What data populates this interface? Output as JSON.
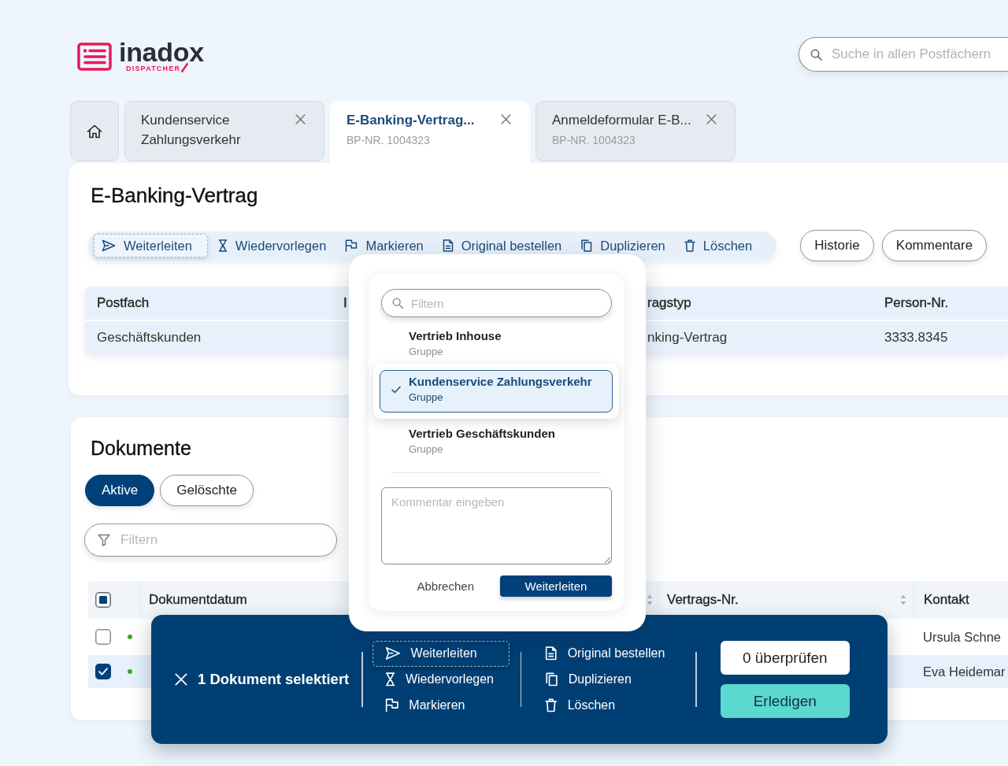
{
  "logo": {
    "name": "inadox",
    "tagline": "DISPATCHER"
  },
  "search": {
    "placeholder": "Suche in allen Postfächern"
  },
  "tabs": [
    {
      "kind": "home",
      "selected": false
    },
    {
      "kind": "document",
      "title": "Kundenservice Zahlungsverkehr",
      "selected": false
    },
    {
      "kind": "document",
      "title": "E-Banking-Vertrag...",
      "subtitle": "BP-NR. 1004323",
      "selected": true
    },
    {
      "kind": "document",
      "title": "Anmeldeformular E-B...",
      "subtitle": "BP-NR. 1004323",
      "selected": false
    }
  ],
  "detail": {
    "title": "E-Banking-Vertrag",
    "actions": [
      {
        "kind": "forward",
        "label": "Weiterleiten",
        "selected": true
      },
      {
        "kind": "resubmit",
        "label": "Wiedervorlegen",
        "selected": false
      },
      {
        "kind": "mark",
        "label": "Markieren",
        "selected": false
      },
      {
        "kind": "order",
        "label": "Original bestellen",
        "selected": false
      },
      {
        "kind": "duplicate",
        "label": "Duplizieren",
        "selected": false
      },
      {
        "kind": "delete",
        "label": "Löschen",
        "selected": false
      }
    ],
    "buttons": [
      "Historie",
      "Kommentare"
    ],
    "table": {
      "columns": [
        "Postfach",
        "I",
        "ragstyp",
        "Person-Nr."
      ],
      "rows": [
        [
          "Geschäftskunden",
          null,
          "nking-Vertrag",
          "3333.8345"
        ]
      ]
    }
  },
  "documents": {
    "title": "Dokumente",
    "filters": [
      {
        "label": "Aktive",
        "selected": true
      },
      {
        "label": "Gelöschte",
        "selected": false
      }
    ],
    "filter_field": {
      "placeholder": "Filtern"
    },
    "table": {
      "select_all": {
        "indeterminate": true
      },
      "columns": [
        {
          "label": "Dokumentdatum",
          "sortable": false
        },
        {
          "sortable": true
        },
        {
          "label": "Vertrags-Nr.",
          "sortable": true
        },
        {
          "label": "Kontakt",
          "sortable": false
        }
      ],
      "rows": [
        {
          "checked": false,
          "selected": false,
          "color": "#3ea52b",
          "contact": "Ursula Schne"
        },
        {
          "checked": true,
          "selected": true,
          "color": "#3ea52b",
          "contact": "Eva Heidemar"
        }
      ]
    }
  },
  "forward_dialog": {
    "filter": {
      "placeholder": "Filtern"
    },
    "recipients": [
      {
        "name": "Vertrieb Inhouse",
        "type": "Gruppe",
        "selected": false
      },
      {
        "name": "Kundenservice Zahlungsverkehr",
        "type": "Gruppe",
        "selected": true
      },
      {
        "name": "Vertrieb Geschäftskunden",
        "type": "Gruppe",
        "selected": false
      }
    ],
    "comment": {
      "placeholder": "Kommentar eingeben"
    },
    "buttons": [
      {
        "label": "Abbrechen",
        "kind": "secondary"
      },
      {
        "label": "Weiterleiten",
        "kind": "primary"
      }
    ]
  },
  "selection_bar": {
    "label": "1 Dokument selektiert",
    "action_groups": [
      [
        {
          "kind": "forward",
          "label": "Weiterleiten",
          "focused": true
        },
        {
          "kind": "resubmit",
          "label": "Wiedervorlegen",
          "focused": false
        },
        {
          "kind": "mark",
          "label": "Markieren",
          "focused": false
        }
      ],
      [
        {
          "kind": "order",
          "label": "Original bestellen",
          "focused": false
        },
        {
          "kind": "duplicate",
          "label": "Duplizieren",
          "focused": false
        },
        {
          "kind": "delete",
          "label": "Löschen",
          "focused": false
        }
      ]
    ],
    "buttons": [
      {
        "label": "0 überprüfen",
        "kind": "secondary"
      },
      {
        "label": "Erledigen",
        "kind": "primary"
      }
    ]
  }
}
